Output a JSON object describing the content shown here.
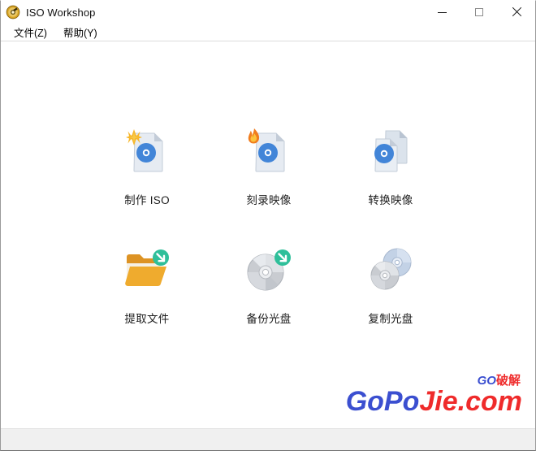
{
  "window": {
    "title": "ISO Workshop",
    "app_icon": "iso-disc-logo-icon",
    "controls": {
      "minimize_label": "—",
      "minimize_icon": "minimize-icon",
      "maximize_label": "□",
      "maximize_icon": "maximize-icon",
      "close_label": "✕",
      "close_icon": "close-icon"
    }
  },
  "menubar": {
    "items": [
      {
        "label": "文件(Z)",
        "name": "menu-file"
      },
      {
        "label": "帮助(Y)",
        "name": "menu-help"
      }
    ]
  },
  "main": {
    "tiles": [
      {
        "label": "制作 ISO",
        "icon": "make-iso-icon"
      },
      {
        "label": "刻录映像",
        "icon": "burn-image-icon"
      },
      {
        "label": "转换映像",
        "icon": "convert-image-icon"
      },
      {
        "label": "提取文件",
        "icon": "extract-files-icon"
      },
      {
        "label": "备份光盘",
        "icon": "backup-disc-icon"
      },
      {
        "label": "复制光盘",
        "icon": "copy-disc-icon"
      }
    ]
  },
  "watermark": {
    "sup_go": "GO",
    "sup_cn": "破解",
    "main_part1": "GoPo",
    "main_part2": "Jie",
    "main_part3": ".com"
  },
  "colors": {
    "disc_blue": "#4285d8",
    "page_grey": "#ccd6e2",
    "folder_orange": "#eda52e",
    "badge_green": "#2fbf9a",
    "flame_orange": "#f08b1d",
    "star_yellow": "#f7b72b",
    "watermark_blue": "#3b4fd0",
    "watermark_red": "#ef2b2b",
    "statusbar": "#f0f0f0"
  }
}
